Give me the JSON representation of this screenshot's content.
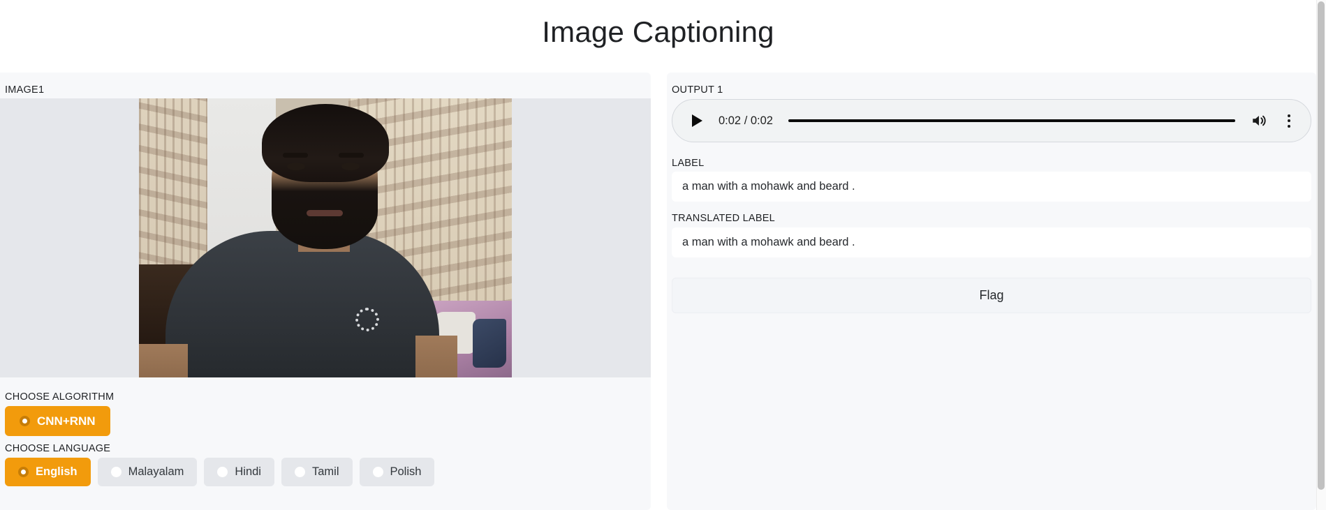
{
  "page": {
    "title": "Image Captioning"
  },
  "left": {
    "image_label": "IMAGE1",
    "image_alt": "webcam-photo-of-bearded-man",
    "algorithm": {
      "label": "CHOOSE ALGORITHM",
      "options": [
        {
          "label": "CNN+RNN",
          "selected": true
        }
      ],
      "selected_value": "CNN+RNN"
    },
    "language": {
      "label": "CHOOSE LANGUAGE",
      "options": [
        {
          "label": "English",
          "selected": true
        },
        {
          "label": "Malayalam",
          "selected": false
        },
        {
          "label": "Hindi",
          "selected": false
        },
        {
          "label": "Tamil",
          "selected": false
        },
        {
          "label": "Polish",
          "selected": false
        }
      ],
      "selected_value": "English"
    }
  },
  "right": {
    "output_label": "OUTPUT 1",
    "audio": {
      "current_time": "0:02",
      "duration": "0:02",
      "time_display": "0:02 / 0:02",
      "play_icon": "play-icon",
      "volume_icon": "volume-icon",
      "menu_icon": "kebab-menu-icon",
      "progress_percent": 100
    },
    "label_field": {
      "label": "LABEL",
      "value": "a man with a mohawk and beard ."
    },
    "translated_field": {
      "label": "TRANSLATED LABEL",
      "value": "a man with a mohawk and beard ."
    },
    "flag_button": "Flag"
  },
  "colors": {
    "accent_orange": "#f29b0c",
    "panel_bg": "#f7f8fa",
    "pill_bg": "#e5e7eb",
    "image_bg": "#e5e7eb",
    "text": "#1f2124"
  }
}
